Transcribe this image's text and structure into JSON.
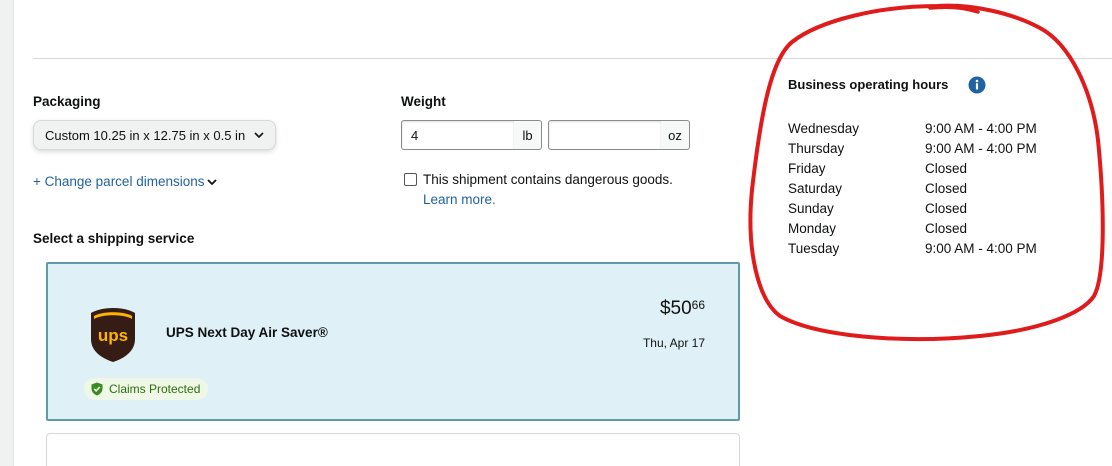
{
  "packaging": {
    "label": "Packaging",
    "selected": "Custom 10.25 in x 12.75 in x 0.5 in",
    "change_link": "+ Change parcel dimensions"
  },
  "weight": {
    "label": "Weight",
    "lb_value": "4",
    "lb_unit": "lb",
    "oz_value": "",
    "oz_unit": "oz"
  },
  "dangerous_goods": {
    "label": "This shipment contains dangerous goods.",
    "checked": false,
    "learn_more": "Learn more."
  },
  "shipping": {
    "section_label": "Select a shipping service",
    "services": [
      {
        "name": "UPS Next Day Air Saver®",
        "carrier_logo": "ups-logo",
        "price_dollars": "$50",
        "price_cents": "66",
        "delivery_date": "Thu, Apr 17",
        "badge": "Claims Protected",
        "selected": true
      }
    ]
  },
  "business_hours": {
    "title": "Business operating hours",
    "rows": [
      {
        "day": "Wednesday",
        "hours": "9:00 AM - 4:00 PM"
      },
      {
        "day": "Thursday",
        "hours": "9:00 AM - 4:00 PM"
      },
      {
        "day": "Friday",
        "hours": "Closed"
      },
      {
        "day": "Saturday",
        "hours": "Closed"
      },
      {
        "day": "Sunday",
        "hours": "Closed"
      },
      {
        "day": "Monday",
        "hours": "Closed"
      },
      {
        "day": "Tuesday",
        "hours": "9:00 AM - 4:00 PM"
      }
    ]
  },
  "colors": {
    "link": "#2162a1",
    "selected_card_bg": "#dff1f6",
    "selected_card_border": "#5f9ca6",
    "info_icon": "#2162a1",
    "annotation_red": "#e01b1b",
    "claims_green": "#2c6e0f"
  }
}
